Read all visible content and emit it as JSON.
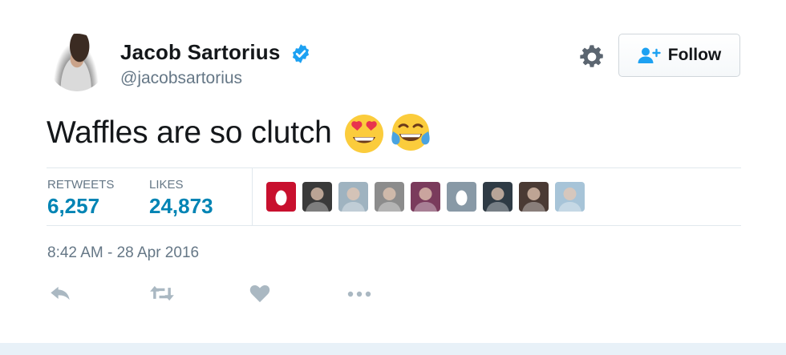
{
  "tweet": {
    "author": {
      "display_name": "Jacob Sartorius",
      "handle": "@jacobsartorius",
      "verified": true,
      "avatar_icon": "profile-photo"
    },
    "follow_label": "Follow",
    "settings_icon": "gear-icon",
    "text": "Waffles are so clutch",
    "emojis": [
      "smiling-face-with-heart-eyes",
      "face-with-tears-of-joy"
    ],
    "stats": {
      "retweets_label": "RETWEETS",
      "retweets_value": "6,257",
      "likes_label": "LIKES",
      "likes_value": "24,873"
    },
    "likers": [
      {
        "icon": "default-egg-avatar",
        "color": "#c8102e"
      },
      {
        "icon": "user-avatar",
        "color": "#3a3a3a"
      },
      {
        "icon": "user-avatar",
        "color": "#9fb3c0"
      },
      {
        "icon": "user-avatar",
        "color": "#8c8c8c"
      },
      {
        "icon": "user-avatar",
        "color": "#7a3b5c"
      },
      {
        "icon": "default-egg-avatar",
        "color": "#8899a6"
      },
      {
        "icon": "user-avatar",
        "color": "#2f3b45"
      },
      {
        "icon": "user-avatar",
        "color": "#4a3a34"
      },
      {
        "icon": "user-avatar",
        "color": "#a7c4d8"
      }
    ],
    "timestamp": "8:42 AM - 28 Apr 2016",
    "actions": [
      "reply-icon",
      "retweet-icon",
      "like-icon",
      "more-icon"
    ]
  },
  "colors": {
    "link": "#0084b4",
    "secondary_text": "#657786",
    "verified_blue": "#1da1f2",
    "action_icon": "#aab8c2"
  }
}
